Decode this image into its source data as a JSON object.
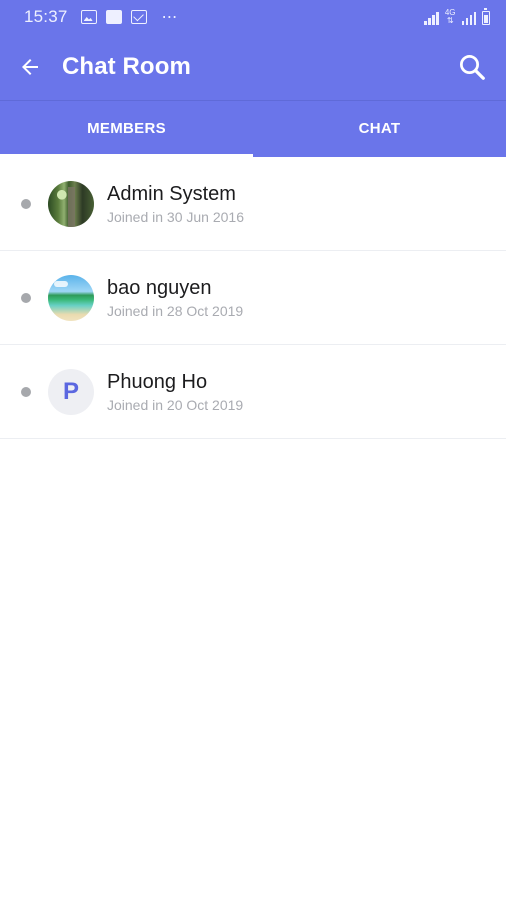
{
  "status_bar": {
    "time": "15:37",
    "dots": "⋯",
    "network_label_1": "4G",
    "network_label_2": "⇅"
  },
  "app_bar": {
    "title": "Chat Room",
    "back_icon": "arrow-left-icon",
    "search_icon": "search-icon"
  },
  "tabs": [
    {
      "label": "MEMBERS",
      "active": true
    },
    {
      "label": "CHAT",
      "active": false
    }
  ],
  "members": [
    {
      "name": "Admin System",
      "joined": "Joined in 30 Jun 2016",
      "avatar": "photo-forest"
    },
    {
      "name": "bao nguyen",
      "joined": "Joined in 28 Oct 2019",
      "avatar": "photo-beach"
    },
    {
      "name": "Phuong Ho",
      "joined": "Joined in 20 Oct 2019",
      "avatar_letter": "P"
    }
  ],
  "colors": {
    "primary": "#6a75ea",
    "status_dot": "#a6a8ac",
    "avatar_letter": "#5b67e0"
  }
}
